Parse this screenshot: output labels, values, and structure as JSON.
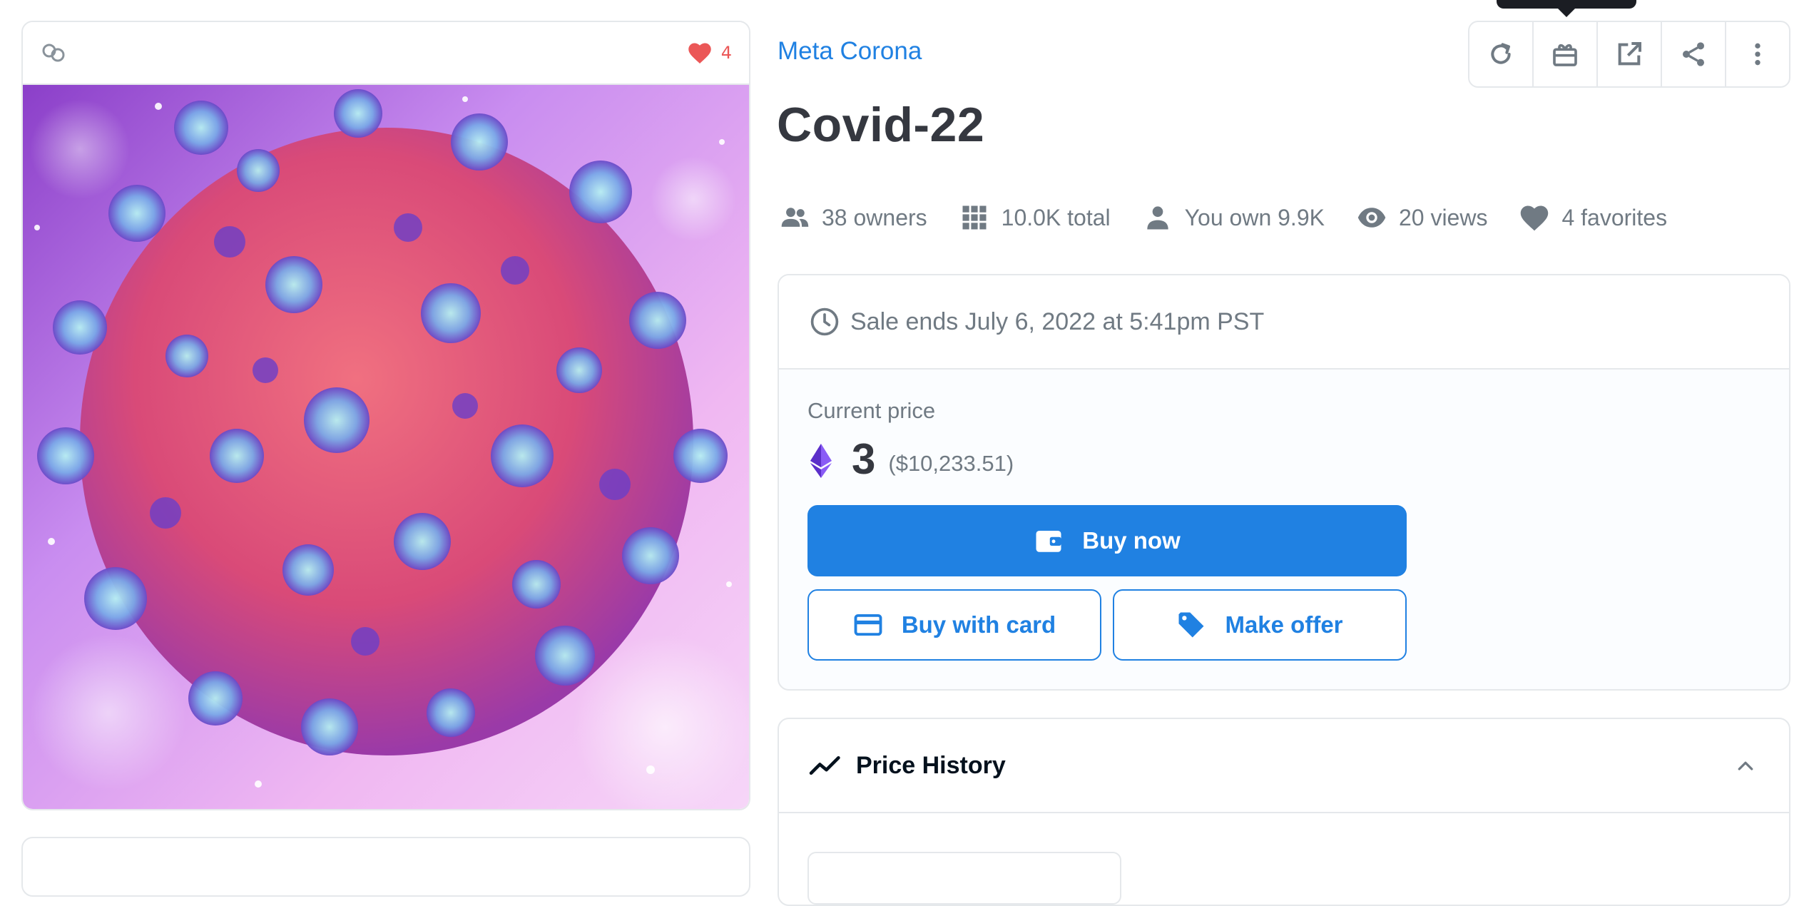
{
  "media": {
    "favorites_count": "4",
    "icons": {
      "chain": "chain-link-icon",
      "favorite": "heart-icon"
    }
  },
  "item": {
    "collection": "Meta Corona",
    "title": "Covid-22"
  },
  "actions": [
    {
      "name": "refresh-metadata",
      "icon": "refresh-icon"
    },
    {
      "name": "transfer",
      "icon": "gift-icon"
    },
    {
      "name": "view-on-site",
      "icon": "external-link-icon"
    },
    {
      "name": "share",
      "icon": "share-icon"
    },
    {
      "name": "more",
      "icon": "more-vertical-icon"
    }
  ],
  "stats": {
    "owners": "38 owners",
    "total": "10.0K total",
    "you_own": "You own 9.9K",
    "views": "20 views",
    "favorites": "4 favorites"
  },
  "sale": {
    "ends_text": "Sale ends July 6, 2022 at 5:41pm PST",
    "price_label": "Current price",
    "price": "3",
    "price_fiat": "($10,233.51)",
    "buy_now_label": "Buy now",
    "buy_card_label": "Buy with card",
    "make_offer_label": "Make offer"
  },
  "price_history": {
    "title": "Price History"
  },
  "colors": {
    "accent": "#2081e2",
    "heart": "#eb5757",
    "text_primary": "#353840",
    "text_secondary": "#707a83",
    "border": "#e5e8eb"
  }
}
